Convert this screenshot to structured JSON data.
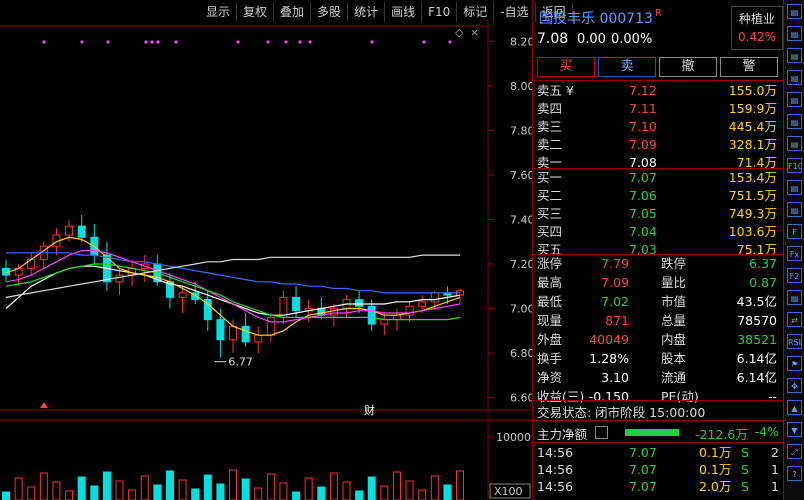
{
  "toolbar": {
    "items": [
      "显示",
      "复权",
      "叠加",
      "多股",
      "统计",
      "画线",
      "F10",
      "标记",
      "-自选",
      "返回"
    ]
  },
  "stock": {
    "name": "国投丰乐",
    "code": "000713",
    "badge": "R",
    "price": "7.08",
    "change": "0.00",
    "change_pct": "0.00%"
  },
  "sector": {
    "name": "种植业",
    "pct": "0.42%"
  },
  "actions": {
    "buy": "买",
    "sell": "卖",
    "cancel": "撤",
    "alert": "警"
  },
  "orderbook": {
    "asks": [
      {
        "label": "卖五 ¥",
        "price": "7.12",
        "qty": "155.0万",
        "color": "red"
      },
      {
        "label": "卖四",
        "price": "7.11",
        "qty": "159.9万",
        "color": "red"
      },
      {
        "label": "卖三",
        "price": "7.10",
        "qty": "445.4万",
        "color": "red"
      },
      {
        "label": "卖二",
        "price": "7.09",
        "qty": "328.1万",
        "color": "red"
      },
      {
        "label": "卖一",
        "price": "7.08",
        "qty": "71.4万",
        "color": "white"
      }
    ],
    "bids": [
      {
        "label": "买一",
        "price": "7.07",
        "qty": "153.4万",
        "color": "green"
      },
      {
        "label": "买二",
        "price": "7.06",
        "qty": "751.5万",
        "color": "green"
      },
      {
        "label": "买三",
        "price": "7.05",
        "qty": "749.3万",
        "color": "green"
      },
      {
        "label": "买四",
        "price": "7.04",
        "qty": "103.6万",
        "color": "green"
      },
      {
        "label": "买五",
        "price": "7.03",
        "qty": "75.1万",
        "color": "green"
      }
    ]
  },
  "stats": [
    {
      "k1": "涨停",
      "v1": "7.79",
      "c1": "red",
      "k2": "跌停",
      "v2": "6.37",
      "c2": "green"
    },
    {
      "k1": "最高",
      "v1": "7.09",
      "c1": "red",
      "k2": "量比",
      "v2": "0.87",
      "c2": "green"
    },
    {
      "k1": "最低",
      "v1": "7.02",
      "c1": "green",
      "k2": "市值",
      "v2": "43.5亿",
      "c2": "white"
    },
    {
      "k1": "现量",
      "v1": "871",
      "c1": "red",
      "k2": "总量",
      "v2": "78570",
      "c2": "white"
    },
    {
      "k1": "外盘",
      "v1": "40049",
      "c1": "red",
      "k2": "内盘",
      "v2": "38521",
      "c2": "green"
    },
    {
      "k1": "换手",
      "v1": "1.28%",
      "c1": "white",
      "k2": "股本",
      "v2": "6.14亿",
      "c2": "white"
    },
    {
      "k1": "净资",
      "v1": "3.10",
      "c1": "white",
      "k2": "流通",
      "v2": "6.14亿",
      "c2": "white"
    },
    {
      "k1": "收益(三)",
      "v1": "-0.150",
      "c1": "white",
      "k2": "PE(动)",
      "v2": "--",
      "c2": "white"
    }
  ],
  "status": "交易状态: 闭市阶段 15:00:00",
  "moneyflow": {
    "label": "主力净额",
    "value": "-212.6万",
    "pct": "-4%"
  },
  "ticks": [
    {
      "time": "14:56",
      "price": "7.07",
      "vol": "0.1万",
      "side": "S",
      "count": "2"
    },
    {
      "time": "14:56",
      "price": "7.07",
      "vol": "0.1万",
      "side": "S",
      "count": "1"
    },
    {
      "time": "14:56",
      "price": "7.07",
      "vol": "2.0万",
      "side": "S",
      "count": "1"
    }
  ],
  "chart_data": {
    "type": "candlestick",
    "yticks": [
      "8.20",
      "8.00",
      "7.80",
      "7.60",
      "7.40",
      "7.20",
      "7.00",
      "6.80",
      "6.60"
    ],
    "ylim": [
      6.58,
      8.26
    ],
    "low_annotation": "6.77",
    "event_marker": "财",
    "volume_tick": "10000",
    "volume_unit": "X100",
    "candles": [
      [
        7.18,
        7.22,
        7.12,
        7.15
      ],
      [
        7.15,
        7.2,
        7.1,
        7.18
      ],
      [
        7.18,
        7.25,
        7.15,
        7.22
      ],
      [
        7.22,
        7.3,
        7.18,
        7.28
      ],
      [
        7.28,
        7.36,
        7.24,
        7.33
      ],
      [
        7.33,
        7.4,
        7.3,
        7.37
      ],
      [
        7.37,
        7.42,
        7.3,
        7.32
      ],
      [
        7.32,
        7.38,
        7.2,
        7.24
      ],
      [
        7.24,
        7.3,
        7.08,
        7.12
      ],
      [
        7.12,
        7.18,
        7.06,
        7.15
      ],
      [
        7.15,
        7.22,
        7.1,
        7.18
      ],
      [
        7.18,
        7.24,
        7.12,
        7.2
      ],
      [
        7.2,
        7.24,
        7.1,
        7.12
      ],
      [
        7.12,
        7.16,
        7.0,
        7.05
      ],
      [
        7.05,
        7.1,
        6.98,
        7.07
      ],
      [
        7.07,
        7.12,
        7.02,
        7.04
      ],
      [
        7.04,
        7.08,
        6.9,
        6.95
      ],
      [
        6.95,
        7.0,
        6.78,
        6.86
      ],
      [
        6.86,
        6.95,
        6.8,
        6.92
      ],
      [
        6.92,
        6.98,
        6.83,
        6.85
      ],
      [
        6.85,
        6.92,
        6.8,
        6.88
      ],
      [
        6.88,
        6.98,
        6.85,
        6.96
      ],
      [
        6.96,
        7.08,
        6.93,
        7.05
      ],
      [
        7.05,
        7.1,
        6.96,
        6.99
      ],
      [
        6.99,
        7.04,
        6.94,
        7.0
      ],
      [
        7.0,
        7.05,
        6.95,
        6.97
      ],
      [
        6.97,
        7.02,
        6.92,
        7.0
      ],
      [
        7.0,
        7.06,
        6.96,
        7.04
      ],
      [
        7.04,
        7.08,
        6.98,
        7.01
      ],
      [
        7.01,
        7.04,
        6.9,
        6.93
      ],
      [
        6.93,
        6.98,
        6.88,
        6.95
      ],
      [
        6.95,
        7.0,
        6.9,
        6.97
      ],
      [
        6.97,
        7.03,
        6.94,
        7.01
      ],
      [
        7.01,
        7.06,
        6.98,
        7.03
      ],
      [
        7.03,
        7.08,
        7.0,
        7.07
      ],
      [
        7.07,
        7.1,
        7.02,
        7.06
      ],
      [
        7.06,
        7.09,
        7.02,
        7.08
      ]
    ],
    "ma_lines": [
      {
        "color": "#ffffff",
        "points": [
          7.0,
          7.05,
          7.1,
          7.13,
          7.16,
          7.18,
          7.19,
          7.19,
          7.18,
          7.17,
          7.16,
          7.15,
          7.13,
          7.11,
          7.1,
          7.08,
          7.06,
          7.04,
          7.02,
          7.0,
          6.98,
          6.97,
          6.97,
          6.98,
          6.99,
          7.0,
          7.01,
          7.02,
          7.02,
          7.02,
          7.02,
          7.03,
          7.03,
          7.04,
          7.04,
          7.05,
          7.06
        ]
      },
      {
        "color": "#ffd400",
        "points": [
          7.16,
          7.18,
          7.22,
          7.26,
          7.3,
          7.32,
          7.31,
          7.28,
          7.23,
          7.18,
          7.16,
          7.15,
          7.14,
          7.12,
          7.09,
          7.06,
          7.02,
          6.97,
          6.92,
          6.9,
          6.88,
          6.88,
          6.9,
          6.94,
          6.97,
          6.98,
          6.99,
          7.0,
          7.0,
          6.99,
          6.97,
          6.97,
          6.98,
          6.99,
          7.01,
          7.03,
          7.05
        ]
      },
      {
        "color": "#ff40ff",
        "points": [
          7.12,
          7.13,
          7.15,
          7.18,
          7.21,
          7.24,
          7.26,
          7.26,
          7.25,
          7.23,
          7.21,
          7.19,
          7.17,
          7.15,
          7.13,
          7.11,
          7.08,
          7.05,
          7.02,
          6.99,
          6.96,
          6.94,
          6.94,
          6.95,
          6.96,
          6.97,
          6.98,
          6.98,
          6.99,
          6.99,
          6.98,
          6.98,
          6.98,
          6.99,
          7.0,
          7.01,
          7.02
        ]
      },
      {
        "color": "#20e020",
        "points": [
          7.1,
          7.11,
          7.12,
          7.14,
          7.16,
          7.18,
          7.19,
          7.2,
          7.2,
          7.19,
          7.18,
          7.17,
          7.16,
          7.14,
          7.12,
          7.1,
          7.08,
          7.06,
          7.03,
          7.01,
          6.99,
          6.97,
          6.96,
          6.96,
          6.96,
          6.96,
          6.96,
          6.96,
          6.96,
          6.96,
          6.95,
          6.95,
          6.95,
          6.95,
          6.95,
          6.95,
          6.96
        ]
      },
      {
        "color": "#3a6cff",
        "points": [
          7.25,
          7.25,
          7.25,
          7.25,
          7.25,
          7.25,
          7.24,
          7.24,
          7.23,
          7.22,
          7.21,
          7.21,
          7.2,
          7.19,
          7.18,
          7.17,
          7.16,
          7.15,
          7.14,
          7.13,
          7.12,
          7.12,
          7.11,
          7.11,
          7.1,
          7.1,
          7.09,
          7.09,
          7.08,
          7.08,
          7.07,
          7.07,
          7.07,
          7.07,
          7.07,
          7.07,
          7.07
        ]
      },
      {
        "color": "#dcdcdc",
        "points": [
          7.05,
          7.06,
          7.07,
          7.08,
          7.09,
          7.1,
          7.11,
          7.12,
          7.13,
          7.14,
          7.15,
          7.16,
          7.17,
          7.18,
          7.19,
          7.2,
          7.21,
          7.21,
          7.22,
          7.22,
          7.22,
          7.23,
          7.23,
          7.23,
          7.23,
          7.23,
          7.23,
          7.23,
          7.23,
          7.23,
          7.23,
          7.23,
          7.23,
          7.24,
          7.24,
          7.24,
          7.24
        ]
      }
    ]
  },
  "sidebar_icons": [
    "window-icon",
    "table-icon",
    "grid-icon",
    "chart-icon",
    "bar-icon",
    "list-icon",
    "doc-icon",
    "f10-icon",
    "window2-icon",
    "doc2-icon",
    "f-icon",
    "fx-icon",
    "f2-icon",
    "bar2-icon",
    "swap-icon",
    "rsi-icon",
    "flag-icon",
    "move-icon",
    "arrow-up-icon",
    "arrow-down-icon",
    "fullscreen-icon",
    "help-icon"
  ]
}
